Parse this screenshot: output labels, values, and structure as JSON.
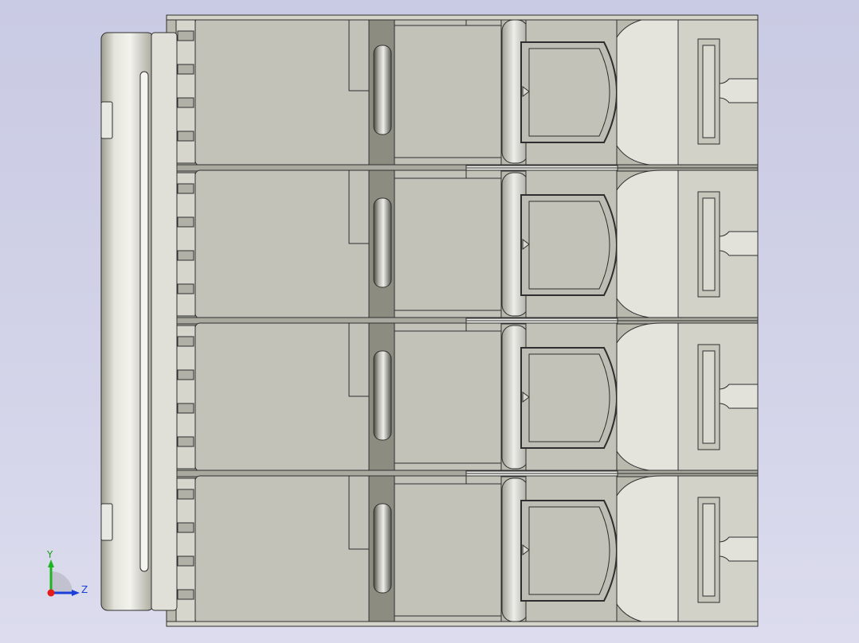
{
  "viewport": {
    "background": "#cfd0e6",
    "body_color": "#c2c2b8",
    "edge_color": "#2f2f2f"
  },
  "model": {
    "pole_count": 4,
    "side_slot_count": 2
  },
  "triad": {
    "y_label": "Y",
    "z_label": "Z",
    "x_axis_color": "#e31b1b",
    "y_axis_color": "#1fb31f",
    "z_axis_color": "#1a3fd9"
  }
}
